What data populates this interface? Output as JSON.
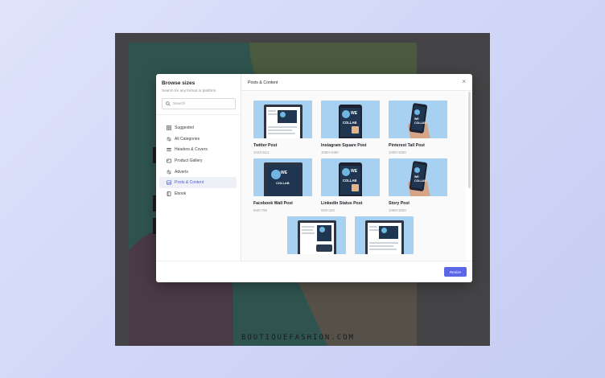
{
  "canvas": {
    "footer_text": "BOUTIQUEFASHION.COM"
  },
  "modal": {
    "title": "Browse sizes",
    "subtitle": "Search for any format or platform",
    "search_placeholder": "Search",
    "content_heading": "Posts & Content",
    "resize_label": "Resize",
    "nav": [
      {
        "label": "Suggested",
        "icon": "grid-icon",
        "active": false
      },
      {
        "label": "All Categories",
        "icon": "arrows-icon",
        "active": false
      },
      {
        "label": "Headers & Covers",
        "icon": "header-icon",
        "active": false
      },
      {
        "label": "Product Gallery",
        "icon": "gallery-icon",
        "active": false
      },
      {
        "label": "Adverts",
        "icon": "arrows-icon",
        "active": false
      },
      {
        "label": "Posts & Content",
        "icon": "image-icon",
        "active": true
      },
      {
        "label": "Ebook",
        "icon": "book-icon",
        "active": false
      }
    ],
    "cards": [
      {
        "title": "Twitter Post",
        "size": "1024×512",
        "mock": "tablet"
      },
      {
        "title": "Instagram Square Post",
        "size": "1080×1080",
        "mock": "phone"
      },
      {
        "title": "Pinterest Tall Post",
        "size": "1000×1500",
        "mock": "hand"
      },
      {
        "title": "Facebook Wall Post",
        "size": "940×788",
        "mock": "tablet-dark"
      },
      {
        "title": "LinkedIn Status Post",
        "size": "520×320",
        "mock": "phone"
      },
      {
        "title": "Story Post",
        "size": "1080×1920",
        "mock": "hand"
      },
      {
        "title": "",
        "size": "",
        "mock": "tablet-map"
      },
      {
        "title": "",
        "size": "",
        "mock": "tablet"
      }
    ]
  },
  "colors": {
    "accent": "#5b67e6",
    "thumb_bg": "#a8d0f0",
    "backdrop": "#d2d8f7"
  }
}
